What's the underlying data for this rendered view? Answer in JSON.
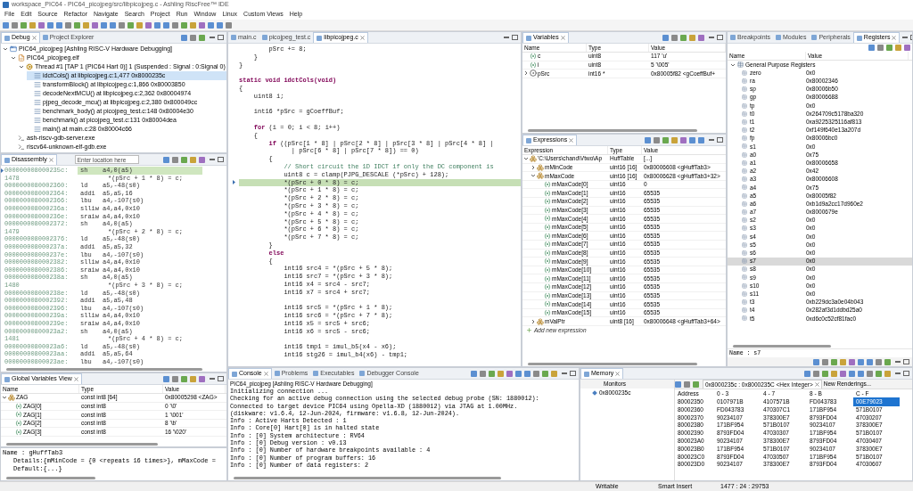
{
  "window": {
    "title": "workspace_PIC64 - PIC64_picojpeg/src/libpicojpeg.c - Ashling RiscFree™ IDE"
  },
  "menu": [
    "File",
    "Edit",
    "Source",
    "Refactor",
    "Navigate",
    "Search",
    "Project",
    "Run",
    "Window",
    "Linux",
    "Custom Views",
    "Help"
  ],
  "debug": {
    "tabs": [
      {
        "label": "Debug",
        "selected": true
      },
      {
        "label": "Project Explorer",
        "selected": false
      }
    ],
    "tree": [
      {
        "kind": "launch",
        "label": "PIC64_picojpeg [Ashling RISC-V Hardware Debugging]",
        "expanded": true,
        "children": [
          {
            "kind": "elf",
            "label": "PIC64_picojpeg.elf",
            "expanded": true,
            "children": [
              {
                "kind": "thread",
                "label": "Thread #1 [TAP 1 (PIC64 Hart 0)] 1 (Suspended : Signal : 0:Signal 0)",
                "expanded": true,
                "children": [
                  {
                    "kind": "frame",
                    "label": "idctCols() at libpicojpeg.c:1,477 0x8000235c",
                    "selected": true
                  },
                  {
                    "kind": "frame",
                    "label": "transformBlock() at libpicojpeg.c:1,866 0x80003850",
                    "selected": false
                  },
                  {
                    "kind": "frame",
                    "label": "decodeNextMCU() at libpicojpeg.c:2,362 0x80004974",
                    "selected": false
                  },
                  {
                    "kind": "frame",
                    "label": "pjpeg_decode_mcu() at libpicojpeg.c:2,380 0x800049cc",
                    "selected": false
                  },
                  {
                    "kind": "frame",
                    "label": "benchmark_body() at picojpeg_test.c:148 0x80004e30",
                    "selected": false
                  },
                  {
                    "kind": "frame",
                    "label": "benchmark() at picojpeg_test.c:131 0x80004dea",
                    "selected": false
                  },
                  {
                    "kind": "frame",
                    "label": "main() at main.c:28 0x80004c66",
                    "selected": false
                  }
                ]
              }
            ]
          },
          {
            "kind": "process",
            "label": "ash-riscv-gdb-server.exe"
          },
          {
            "kind": "process",
            "label": "riscv64-unknown-elf-gdb.exe"
          }
        ]
      }
    ]
  },
  "disassembly": {
    "tabs": [
      {
        "label": "Disassembly",
        "selected": true
      }
    ],
    "location_field": {
      "placeholder": "Enter location here"
    },
    "lines": [
      {
        "kind": "asm",
        "address": "000000008000235c:",
        "mnemonic": "sh",
        "operands": "a4,0(a5)",
        "current": true
      },
      {
        "kind": "src",
        "line": "1478",
        "code": "*(pSrc + 1 * 8) = c;"
      },
      {
        "kind": "asm",
        "address": "0000000080002360:",
        "mnemonic": "ld",
        "operands": "a5,-48(s0)",
        "current": false
      },
      {
        "kind": "asm",
        "address": "0000000080002364:",
        "mnemonic": "addi",
        "operands": "a5,a5,16",
        "current": false
      },
      {
        "kind": "asm",
        "address": "0000000080002366:",
        "mnemonic": "lbu",
        "operands": "a4,-107(s0)",
        "current": false
      },
      {
        "kind": "asm",
        "address": "000000008000236a:",
        "mnemonic": "slliw",
        "operands": "a4,a4,0x10",
        "current": false
      },
      {
        "kind": "asm",
        "address": "000000008000236e:",
        "mnemonic": "sraiw",
        "operands": "a4,a4,0x10",
        "current": false
      },
      {
        "kind": "asm",
        "address": "0000000080002372:",
        "mnemonic": "sh",
        "operands": "a4,0(a5)",
        "current": false
      },
      {
        "kind": "src",
        "line": "1479",
        "code": "*(pSrc + 2 * 8) = c;"
      },
      {
        "kind": "asm",
        "address": "0000000080002376:",
        "mnemonic": "ld",
        "operands": "a5,-48(s0)",
        "current": false
      },
      {
        "kind": "asm",
        "address": "000000008000237a:",
        "mnemonic": "addi",
        "operands": "a5,a5,32",
        "current": false
      },
      {
        "kind": "asm",
        "address": "000000008000237e:",
        "mnemonic": "lbu",
        "operands": "a4,-107(s0)",
        "current": false
      },
      {
        "kind": "asm",
        "address": "0000000080002382:",
        "mnemonic": "slliw",
        "operands": "a4,a4,0x10",
        "current": false
      },
      {
        "kind": "asm",
        "address": "0000000080002386:",
        "mnemonic": "sraiw",
        "operands": "a4,a4,0x10",
        "current": false
      },
      {
        "kind": "asm",
        "address": "000000008000238a:",
        "mnemonic": "sh",
        "operands": "a4,0(a5)",
        "current": false
      },
      {
        "kind": "src",
        "line": "1480",
        "code": "*(pSrc + 3 * 8) = c;"
      },
      {
        "kind": "asm",
        "address": "000000008000238e:",
        "mnemonic": "ld",
        "operands": "a5,-48(s0)",
        "current": false
      },
      {
        "kind": "asm",
        "address": "0000000080002392:",
        "mnemonic": "addi",
        "operands": "a5,a5,48",
        "current": false
      },
      {
        "kind": "asm",
        "address": "0000000080002396:",
        "mnemonic": "lbu",
        "operands": "a4,-107(s0)",
        "current": false
      },
      {
        "kind": "asm",
        "address": "000000008000239a:",
        "mnemonic": "slliw",
        "operands": "a4,a4,0x10",
        "current": false
      },
      {
        "kind": "asm",
        "address": "000000008000239e:",
        "mnemonic": "sraiw",
        "operands": "a4,a4,0x10",
        "current": false
      },
      {
        "kind": "asm",
        "address": "00000000800023a2:",
        "mnemonic": "sh",
        "operands": "a4,0(a5)",
        "current": false
      },
      {
        "kind": "src",
        "line": "1481",
        "code": "*(pSrc + 4 * 8) = c;"
      },
      {
        "kind": "asm",
        "address": "00000000800023a6:",
        "mnemonic": "ld",
        "operands": "a5,-48(s0)",
        "current": false
      },
      {
        "kind": "asm",
        "address": "00000000800023aa:",
        "mnemonic": "addi",
        "operands": "a5,a5,64",
        "current": false
      },
      {
        "kind": "asm",
        "address": "00000000800023ae:",
        "mnemonic": "lbu",
        "operands": "a4,-107(s0)",
        "current": false
      }
    ]
  },
  "global_variables": {
    "tabs": [
      {
        "label": "Global Variables View",
        "selected": true
      }
    ],
    "columns": [
      "Name",
      "Type",
      "Value"
    ],
    "rows": [
      {
        "kind": "struct",
        "name": "ZAG",
        "type": "const int8 [64]",
        "value": "0x80005298 <ZAG>",
        "expanded": true,
        "children": [
          {
            "kind": "scalar",
            "name": "ZAG[0]",
            "type": "const int8",
            "value": "0 '\\0'"
          },
          {
            "kind": "scalar",
            "name": "ZAG[1]",
            "type": "const int8",
            "value": "1 '\\001'"
          },
          {
            "kind": "scalar",
            "name": "ZAG[2]",
            "type": "const int8",
            "value": "8 '\\b'"
          },
          {
            "kind": "scalar",
            "name": "ZAG[3]",
            "type": "const int8",
            "value": "16 '\\020'"
          }
        ]
      }
    ],
    "details": [
      "Name : gHuffTab3",
      "Details:{mMinCode = {0 <repeats 16 times>}, mMaxCode =",
      "Default:{...}"
    ]
  },
  "editor": {
    "tabs": [
      {
        "label": "main.c",
        "selected": false
      },
      {
        "label": "picojpeg_test.c",
        "selected": false
      },
      {
        "label": "libpicojpeg.c",
        "selected": true
      }
    ],
    "lines": [
      {
        "kind": "code",
        "text": "        pSrc += 8;"
      },
      {
        "kind": "code",
        "text": "    }"
      },
      {
        "kind": "code",
        "text": "}"
      },
      {
        "kind": "blank"
      },
      {
        "kind": "code",
        "text": "**static void idctCols(void)**"
      },
      {
        "kind": "code",
        "text": "{"
      },
      {
        "kind": "code",
        "text": "    uint8 i;"
      },
      {
        "kind": "blank"
      },
      {
        "kind": "code",
        "text": "    int16 *pSrc = gCoeffBuf;"
      },
      {
        "kind": "blank"
      },
      {
        "kind": "code",
        "text": "    **for** (i = 0; i < 8; i++)"
      },
      {
        "kind": "code",
        "text": "    {"
      },
      {
        "kind": "code",
        "text": "        **if** ((pSrc[1 * 8] | pSrc[2 * 8] | pSrc[3 * 8] | pSrc[4 * 8] |"
      },
      {
        "kind": "code",
        "text": "              | pSrc[6 * 8] | pSrc[7 * 8]) == 0)"
      },
      {
        "kind": "code",
        "text": "        {"
      },
      {
        "kind": "comment",
        "text": "            // Short circuit the 1D IDCT if only the DC component is"
      },
      {
        "kind": "code",
        "text": "            uint8 c = clamp(PJPG_DESCALE (*pSrc) + 128);"
      },
      {
        "kind": "current",
        "text": "            *(pSrc + 0 * 8) = c;"
      },
      {
        "kind": "code",
        "text": "            *(pSrc + 1 * 8) = c;"
      },
      {
        "kind": "code",
        "text": "            *(pSrc + 2 * 8) = c;"
      },
      {
        "kind": "code",
        "text": "            *(pSrc + 3 * 8) = c;"
      },
      {
        "kind": "code",
        "text": "            *(pSrc + 4 * 8) = c;"
      },
      {
        "kind": "code",
        "text": "            *(pSrc + 5 * 8) = c;"
      },
      {
        "kind": "code",
        "text": "            *(pSrc + 6 * 8) = c;"
      },
      {
        "kind": "code",
        "text": "            *(pSrc + 7 * 8) = c;"
      },
      {
        "kind": "code",
        "text": "        }"
      },
      {
        "kind": "code",
        "text": "        **else**"
      },
      {
        "kind": "code",
        "text": "        {"
      },
      {
        "kind": "code",
        "text": "            int16 src4 = *(pSrc + 5 * 8);"
      },
      {
        "kind": "code",
        "text": "            int16 src7 = *(pSrc + 3 * 8);"
      },
      {
        "kind": "code",
        "text": "            int16 x4 = src4 - src7;"
      },
      {
        "kind": "code",
        "text": "            int16 x7 = src4 + src7;"
      },
      {
        "kind": "blank"
      },
      {
        "kind": "code",
        "text": "            int16 src5 = *(pSrc + 1 * 8);"
      },
      {
        "kind": "code",
        "text": "            int16 src6 = *(pSrc + 7 * 8);"
      },
      {
        "kind": "code",
        "text": "            int16 x5 = src5 + src6;"
      },
      {
        "kind": "code",
        "text": "            int16 x6 = src5 - src6;"
      },
      {
        "kind": "blank"
      },
      {
        "kind": "code",
        "text": "            int16 tmp1 = imul_b5(x4 - x6);"
      },
      {
        "kind": "code",
        "text": "            int16 stg26 = imul_b4(x6) - tmp1;"
      }
    ]
  },
  "variables": {
    "tabs": [
      {
        "label": "Variables",
        "selected": true
      }
    ],
    "columns": [
      "Name",
      "Type",
      "Value"
    ],
    "rows": [
      {
        "kind": "scalar",
        "name": "c",
        "type": "uint8",
        "value": "117 'u'"
      },
      {
        "kind": "scalar",
        "name": "i",
        "type": "uint8",
        "value": "5 '\\005'"
      },
      {
        "kind": "pointer",
        "name": "pSrc",
        "type": "int16 *",
        "value": "0x80005f82 <gCoeffBuf+",
        "expanded": false
      }
    ]
  },
  "expressions": {
    "tabs": [
      {
        "label": "Expressions",
        "selected": true
      }
    ],
    "columns": [
      "Expression",
      "Type",
      "Value"
    ],
    "rows": [
      {
        "kind": "struct",
        "name": "'C:\\Users\\chand\\Vtwo\\Ap",
        "type": "HuffTable",
        "value": "[...]",
        "expanded": true,
        "children": [
          {
            "kind": "struct",
            "name": "mMinCode",
            "type": "uint16 [16]",
            "value": "0x80006608 <gHuffTab3>",
            "expanded": false
          },
          {
            "kind": "struct",
            "name": "mMaxCode",
            "type": "uint16 [16]",
            "value": "0x80006628 <gHuffTab3+32>",
            "expanded": true,
            "children": [
              {
                "kind": "scalar",
                "name": "mMaxCode[0]",
                "type": "uint16",
                "value": "0"
              },
              {
                "kind": "scalar",
                "name": "mMaxCode[1]",
                "type": "uint16",
                "value": "65535"
              },
              {
                "kind": "scalar",
                "name": "mMaxCode[2]",
                "type": "uint16",
                "value": "65535"
              },
              {
                "kind": "scalar",
                "name": "mMaxCode[3]",
                "type": "uint16",
                "value": "65535"
              },
              {
                "kind": "scalar",
                "name": "mMaxCode[4]",
                "type": "uint16",
                "value": "65535"
              },
              {
                "kind": "scalar",
                "name": "mMaxCode[5]",
                "type": "uint16",
                "value": "65535"
              },
              {
                "kind": "scalar",
                "name": "mMaxCode[6]",
                "type": "uint16",
                "value": "65535"
              },
              {
                "kind": "scalar",
                "name": "mMaxCode[7]",
                "type": "uint16",
                "value": "65535"
              },
              {
                "kind": "scalar",
                "name": "mMaxCode[8]",
                "type": "uint16",
                "value": "65535"
              },
              {
                "kind": "scalar",
                "name": "mMaxCode[9]",
                "type": "uint16",
                "value": "65535"
              },
              {
                "kind": "scalar",
                "name": "mMaxCode[10]",
                "type": "uint16",
                "value": "65535"
              },
              {
                "kind": "scalar",
                "name": "mMaxCode[11]",
                "type": "uint16",
                "value": "65535"
              },
              {
                "kind": "scalar",
                "name": "mMaxCode[12]",
                "type": "uint16",
                "value": "65535"
              },
              {
                "kind": "scalar",
                "name": "mMaxCode[13]",
                "type": "uint16",
                "value": "65535"
              },
              {
                "kind": "scalar",
                "name": "mMaxCode[14]",
                "type": "uint16",
                "value": "65535"
              },
              {
                "kind": "scalar",
                "name": "mMaxCode[15]",
                "type": "uint16",
                "value": "65535"
              }
            ]
          },
          {
            "kind": "struct",
            "name": "mValPtr",
            "type": "uint8 [16]",
            "value": "0x80006648 <gHuffTab3+64>",
            "expanded": false
          }
        ]
      }
    ],
    "add_expression": "Add new expression"
  },
  "registers": {
    "tabs": [
      {
        "label": "Breakpoints",
        "selected": false
      },
      {
        "label": "Modules",
        "selected": false
      },
      {
        "label": "Peripherals",
        "selected": false
      },
      {
        "label": "Registers",
        "selected": true
      }
    ],
    "columns": [
      "Name",
      "Value"
    ],
    "groups": [
      {
        "name": "General Purpose Registers",
        "expanded": true,
        "children": [
          {
            "name": "zero",
            "value": "0x0",
            "selected": false
          },
          {
            "name": "ra",
            "value": "0x80002346",
            "selected": false
          },
          {
            "name": "sp",
            "value": "0x80006b50",
            "selected": false
          },
          {
            "name": "gp",
            "value": "0x80006688",
            "selected": false
          },
          {
            "name": "tp",
            "value": "0x0",
            "selected": false
          },
          {
            "name": "t0",
            "value": "0x264709c5178ba320",
            "selected": false
          },
          {
            "name": "t1",
            "value": "0xa9225325116af813",
            "selected": false
          },
          {
            "name": "t2",
            "value": "0xf149f640e13a207d",
            "selected": false
          },
          {
            "name": "fp",
            "value": "0x80006bc0",
            "selected": false
          },
          {
            "name": "s1",
            "value": "0x0",
            "selected": false
          },
          {
            "name": "a0",
            "value": "0x75",
            "selected": false
          },
          {
            "name": "a1",
            "value": "0x80006658",
            "selected": false
          },
          {
            "name": "a2",
            "value": "0x42",
            "selected": false
          },
          {
            "name": "a3",
            "value": "0x80006608",
            "selected": false
          },
          {
            "name": "a4",
            "value": "0x75",
            "selected": false
          },
          {
            "name": "a5",
            "value": "0x80005f82",
            "selected": false
          },
          {
            "name": "a6",
            "value": "0xb1d9a2cc17d960e2",
            "selected": false
          },
          {
            "name": "a7",
            "value": "0x8000679e",
            "selected": false
          },
          {
            "name": "s2",
            "value": "0x0",
            "selected": false
          },
          {
            "name": "s3",
            "value": "0x0",
            "selected": false
          },
          {
            "name": "s4",
            "value": "0x0",
            "selected": false
          },
          {
            "name": "s5",
            "value": "0x0",
            "selected": false
          },
          {
            "name": "s6",
            "value": "0x0",
            "selected": false
          },
          {
            "name": "s7",
            "value": "0x0",
            "selected": true
          },
          {
            "name": "s8",
            "value": "0x0",
            "selected": false
          },
          {
            "name": "s9",
            "value": "0x0",
            "selected": false
          },
          {
            "name": "s10",
            "value": "0x0",
            "selected": false
          },
          {
            "name": "s11",
            "value": "0x0",
            "selected": false
          },
          {
            "name": "t3",
            "value": "0xb229dc3a0e04b043",
            "selected": false
          },
          {
            "name": "t4",
            "value": "0x282af3d1ddbd25a0",
            "selected": false
          },
          {
            "name": "t5",
            "value": "0xd6c0c52cf81fac0",
            "selected": false
          }
        ]
      }
    ],
    "details": "Name : s7"
  },
  "console": {
    "tabs": [
      {
        "label": "Console",
        "selected": true
      },
      {
        "label": "Problems",
        "selected": false
      },
      {
        "label": "Executables",
        "selected": false
      },
      {
        "label": "Debugger Console",
        "selected": false
      }
    ],
    "session": "PIC64_picojpeg [Ashling RISC-V Hardware Debugging]",
    "lines": [
      "Initializing connection ...",
      "Checking for an active debug connection using the selected debug probe (SN: 1880012):",
      "Connected to target device PIC64 using Opella-XD (1880012) via JTAG at 1.00MHz.",
      "(diskware: v1.6.4, 12-Jun-2024, firmware: v1.6.8, 12-Jun-2024).",
      "Info : Active Harts Detected : 1",
      "Info : Core[0] Hart[0] is in halted state",
      "Info : [0] System architecture : RV64",
      "Info : [0] Debug version : v0.13",
      "Info : [0] Number of hardware breakpoints available : 4",
      "Info : [0] Number of program buffers: 16",
      "Info : [0] Number of data registers: 2"
    ]
  },
  "memory": {
    "tabs": [
      {
        "label": "Memory",
        "selected": true
      }
    ],
    "monitors_label": "Monitors",
    "monitors": [
      "0x8000235c"
    ],
    "rendering_tabs": [
      {
        "label": "0x8000235c : 0x8000235C <Hex Integer>",
        "selected": true
      },
      {
        "label": "New Renderings...",
        "selected": false
      }
    ],
    "address_column": "Address",
    "columns": [
      "0 - 3",
      "4 - 7",
      "8 - B",
      "C - F"
    ],
    "rows": [
      {
        "address": "80002350",
        "cells": [
          {
            "text": "0107971B",
            "selected": false
          },
          {
            "text": "4107571B",
            "selected": false
          },
          {
            "text": "FD043783",
            "selected": false
          },
          {
            "text": "00E79023",
            "selected": true
          }
        ]
      },
      {
        "address": "80002360",
        "cells": [
          {
            "text": "FD043783",
            "selected": false
          },
          {
            "text": "470307C1",
            "selected": false
          },
          {
            "text": "171BF954",
            "selected": false
          },
          {
            "text": "571B0107",
            "selected": false
          }
        ]
      },
      {
        "address": "80002370",
        "cells": [
          {
            "text": "90234107",
            "selected": false
          },
          {
            "text": "378300E7",
            "selected": false
          },
          {
            "text": "8793FD04",
            "selected": false
          },
          {
            "text": "47030207",
            "selected": false
          }
        ]
      },
      {
        "address": "80002380",
        "cells": [
          {
            "text": "171BF954",
            "selected": false
          },
          {
            "text": "571B0107",
            "selected": false
          },
          {
            "text": "90234107",
            "selected": false
          },
          {
            "text": "378300E7",
            "selected": false
          }
        ]
      },
      {
        "address": "80002390",
        "cells": [
          {
            "text": "8793FD04",
            "selected": false
          },
          {
            "text": "47030307",
            "selected": false
          },
          {
            "text": "171BF954",
            "selected": false
          },
          {
            "text": "571B0107",
            "selected": false
          }
        ]
      },
      {
        "address": "800023A0",
        "cells": [
          {
            "text": "90234107",
            "selected": false
          },
          {
            "text": "378300E7",
            "selected": false
          },
          {
            "text": "8793FD04",
            "selected": false
          },
          {
            "text": "47030407",
            "selected": false
          }
        ]
      },
      {
        "address": "800023B0",
        "cells": [
          {
            "text": "171BF954",
            "selected": false
          },
          {
            "text": "571B0107",
            "selected": false
          },
          {
            "text": "90234107",
            "selected": false
          },
          {
            "text": "378300E7",
            "selected": false
          }
        ]
      },
      {
        "address": "800023C0",
        "cells": [
          {
            "text": "8793FD04",
            "selected": false
          },
          {
            "text": "47030507",
            "selected": false
          },
          {
            "text": "171BF954",
            "selected": false
          },
          {
            "text": "571B0107",
            "selected": false
          }
        ]
      },
      {
        "address": "800023D0",
        "cells": [
          {
            "text": "90234107",
            "selected": false
          },
          {
            "text": "378300E7",
            "selected": false
          },
          {
            "text": "8793FD04",
            "selected": false
          },
          {
            "text": "47030607",
            "selected": false
          }
        ]
      }
    ]
  },
  "status_bar": [
    "Writable",
    "Smart Insert",
    "1477 : 24 : 29753"
  ]
}
